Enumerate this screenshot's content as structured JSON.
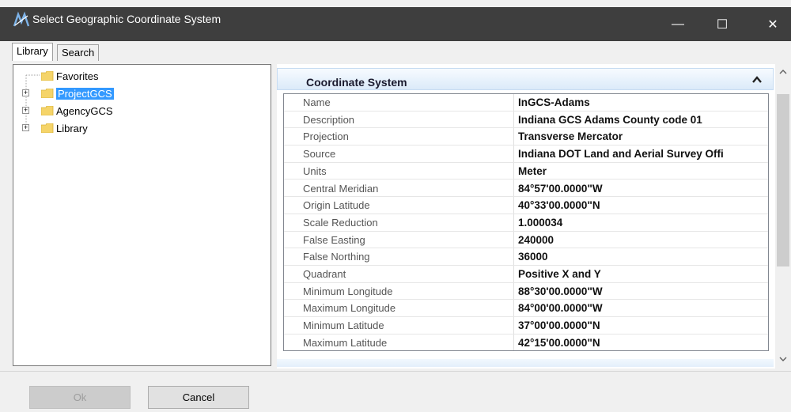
{
  "window": {
    "title": "Select Geographic Coordinate System",
    "minimize_glyph": "—",
    "maximize_glyph": "☐",
    "close_glyph": "✕"
  },
  "tabs": [
    {
      "label": "Library",
      "active": true
    },
    {
      "label": "Search",
      "active": false
    }
  ],
  "tree": {
    "items": [
      {
        "label": "Favorites",
        "expandable": false,
        "selected": false
      },
      {
        "label": "ProjectGCS",
        "expandable": true,
        "selected": true
      },
      {
        "label": "AgencyGCS",
        "expandable": true,
        "selected": false
      },
      {
        "label": "Library",
        "expandable": true,
        "selected": false
      }
    ]
  },
  "details": {
    "section_title": "Coordinate System",
    "rows": [
      {
        "name": "Name",
        "value": "InGCS-Adams"
      },
      {
        "name": "Description",
        "value": "Indiana GCS Adams County code 01"
      },
      {
        "name": "Projection",
        "value": "Transverse Mercator"
      },
      {
        "name": "Source",
        "value": "Indiana DOT Land and Aerial Survey Offi"
      },
      {
        "name": "Units",
        "value": "Meter"
      },
      {
        "name": "Central Meridian",
        "value": "84°57'00.0000\"W"
      },
      {
        "name": "Origin Latitude",
        "value": "40°33'00.0000\"N"
      },
      {
        "name": "Scale Reduction",
        "value": "1.000034"
      },
      {
        "name": "False Easting",
        "value": "240000"
      },
      {
        "name": "False Northing",
        "value": "36000"
      },
      {
        "name": "Quadrant",
        "value": "Positive X and Y"
      },
      {
        "name": "Minimum Longitude",
        "value": "88°30'00.0000\"W"
      },
      {
        "name": "Maximum Longitude",
        "value": "84°00'00.0000\"W"
      },
      {
        "name": "Minimum Latitude",
        "value": "37°00'00.0000\"N"
      },
      {
        "name": "Maximum Latitude",
        "value": "42°15'00.0000\"N"
      }
    ]
  },
  "buttons": {
    "ok_label": "Ok",
    "cancel_label": "Cancel"
  },
  "colors": {
    "titlebar": "#3e3e3e",
    "selection": "#3399ff",
    "folder": "#f5d469"
  }
}
